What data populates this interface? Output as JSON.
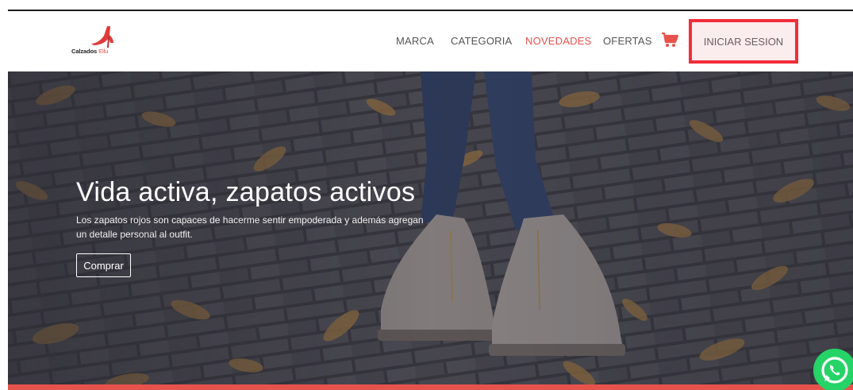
{
  "brand": {
    "name_part1": "Calzados",
    "name_part2": "Ellu",
    "logo_icon": "high-heel-shoe-icon"
  },
  "nav": {
    "items": [
      {
        "label": "MARCA"
      },
      {
        "label": "CATEGORIA"
      },
      {
        "label": "NOVEDADES",
        "active": true
      },
      {
        "label": "OFERTAS"
      }
    ],
    "cart_icon": "shopping-cart-icon",
    "login_label": "INICIAR SESION"
  },
  "hero": {
    "title": "Vida activa, zapatos activos",
    "text": "Los zapatos rojos son capaces de hacerme sentir empoderada y además agregan un detalle personal al outfit.",
    "button_label": "Comprar"
  },
  "whatsapp_icon": "whatsapp-icon",
  "colors": {
    "accent": "#e8524d",
    "highlight_border": "#f22d3a",
    "whatsapp": "#25d366"
  }
}
